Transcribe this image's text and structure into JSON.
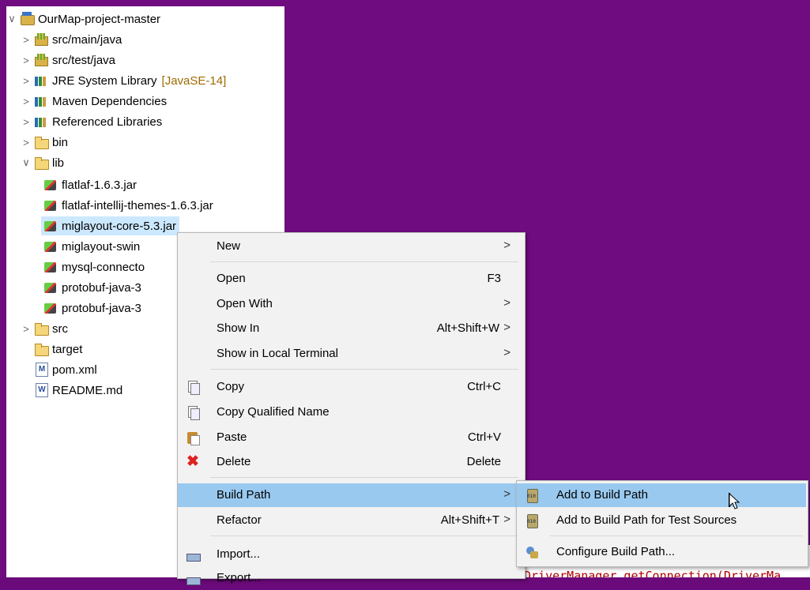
{
  "tree": {
    "project": {
      "label": "OurMap-project-master",
      "toggle": "∨"
    },
    "items": [
      {
        "label": "src/main/java",
        "toggle": ">",
        "icon": "source-folder-icon",
        "suffix": ""
      },
      {
        "label": "src/test/java",
        "toggle": ">",
        "icon": "source-folder-icon",
        "suffix": ""
      },
      {
        "label": "JRE System Library",
        "toggle": ">",
        "icon": "library-icon",
        "suffix": "[JavaSE-14]"
      },
      {
        "label": "Maven Dependencies",
        "toggle": ">",
        "icon": "library-icon",
        "suffix": ""
      },
      {
        "label": "Referenced Libraries",
        "toggle": ">",
        "icon": "library-icon",
        "suffix": ""
      },
      {
        "label": "bin",
        "toggle": ">",
        "icon": "folder-icon",
        "suffix": ""
      },
      {
        "label": "lib",
        "toggle": "∨",
        "icon": "folder-icon",
        "suffix": ""
      }
    ],
    "lib_children": [
      {
        "label": "flatlaf-1.6.3.jar"
      },
      {
        "label": "flatlaf-intellij-themes-1.6.3.jar"
      },
      {
        "label": "miglayout-core-5.3.jar"
      },
      {
        "label": "miglayout-swin"
      },
      {
        "label": "mysql-connecto"
      },
      {
        "label": "protobuf-java-3"
      },
      {
        "label": "protobuf-java-3"
      }
    ],
    "after": [
      {
        "label": "src",
        "toggle": ">",
        "icon": "folder-icon"
      },
      {
        "label": "target",
        "toggle": "",
        "icon": "folder-icon"
      },
      {
        "label": "pom.xml",
        "toggle": "",
        "icon": "maven-file-icon",
        "glyph": "M"
      },
      {
        "label": "README.md",
        "toggle": "",
        "icon": "text-file-icon",
        "glyph": "W"
      }
    ]
  },
  "context_menu": {
    "new": {
      "label": "New",
      "arrow": ">"
    },
    "open": {
      "label": "Open",
      "shortcut": "F3"
    },
    "open_with": {
      "label": "Open With",
      "arrow": ">"
    },
    "show_in": {
      "label": "Show In",
      "shortcut": "Alt+Shift+W",
      "arrow": ">"
    },
    "show_in_terminal": {
      "label": "Show in Local Terminal",
      "arrow": ">"
    },
    "copy": {
      "label": "Copy",
      "shortcut": "Ctrl+C"
    },
    "copy_qualified": {
      "label": "Copy Qualified Name"
    },
    "paste": {
      "label": "Paste",
      "shortcut": "Ctrl+V"
    },
    "delete": {
      "label": "Delete",
      "shortcut": "Delete"
    },
    "build_path": {
      "label": "Build Path",
      "arrow": ">"
    },
    "refactor": {
      "label": "Refactor",
      "shortcut": "Alt+Shift+T",
      "arrow": ">"
    },
    "import": {
      "label": "Import..."
    },
    "export": {
      "label": "Export..."
    }
  },
  "submenu": {
    "add": {
      "label": "Add to Build Path"
    },
    "add_test": {
      "label": "Add to Build Path for Test Sources"
    },
    "configure": {
      "label": "Configure Build Path..."
    }
  },
  "editor": {
    "code": "DriverManager.getConnection(DriverMa"
  },
  "colors": {
    "highlight": "#99c9ef",
    "selection": "#cce8ff",
    "frame": "#6e0c80"
  }
}
